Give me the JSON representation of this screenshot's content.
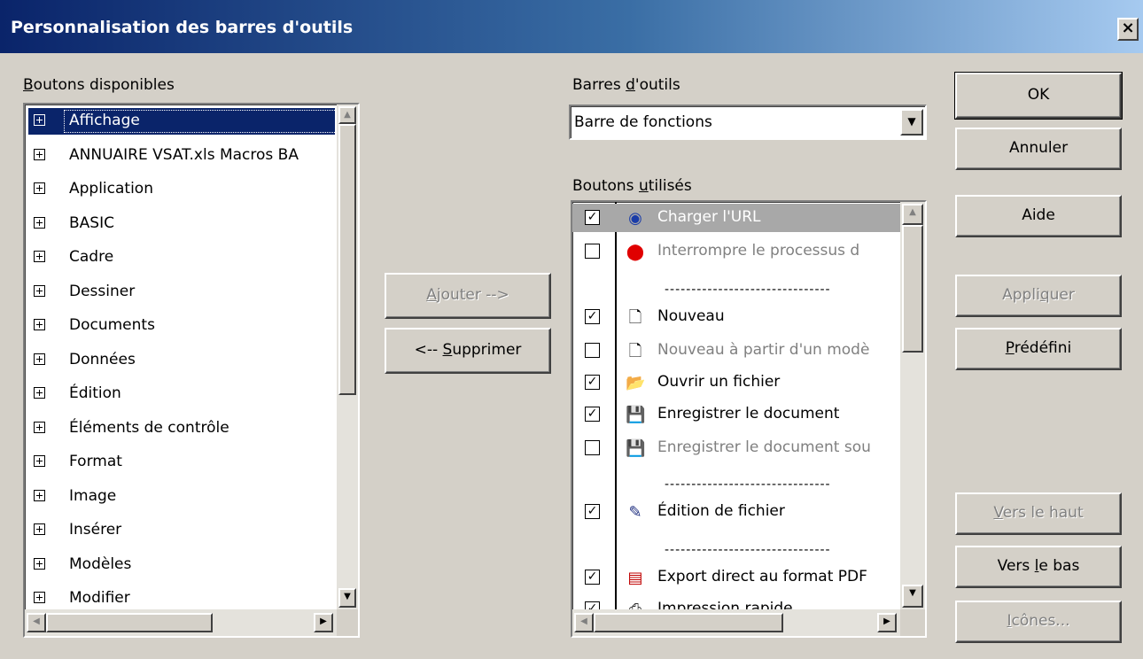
{
  "window": {
    "title": "Personnalisation des barres d'outils",
    "close_glyph": "×"
  },
  "available": {
    "label_prefix": "",
    "label_access": "B",
    "label_rest": "outons disponibles",
    "items": [
      "Affichage",
      "ANNUAIRE VSAT.xls Macros BA",
      "Application",
      "BASIC",
      "Cadre",
      "Dessiner",
      "Documents",
      "Données",
      "Édition",
      "Éléments de contrôle",
      "Format",
      "Image",
      "Insérer",
      "Modèles",
      "Modifier"
    ]
  },
  "middle": {
    "add": {
      "access": "A",
      "rest": "jouter -->"
    },
    "remove": {
      "prefix": "<-- ",
      "access": "S",
      "rest": "upprimer"
    }
  },
  "toolbars": {
    "label_prefix": "Barres ",
    "label_access": "d",
    "label_rest": "'outils",
    "selected": "Barre de fonctions"
  },
  "used": {
    "label_prefix": "Boutons ",
    "label_access": "u",
    "label_rest": "tilisés",
    "items": [
      {
        "checked": true,
        "icon": "url-load-icon",
        "label": "Charger l'URL",
        "dim": false
      },
      {
        "checked": false,
        "icon": "stop-icon",
        "label": "Interrompre le processus d",
        "dim": true
      },
      {
        "separator": true,
        "label": "-------------------------------"
      },
      {
        "checked": true,
        "icon": "new-document-icon",
        "label": "Nouveau",
        "dim": false
      },
      {
        "checked": false,
        "icon": "new-from-template-icon",
        "label": "Nouveau à partir d'un modè",
        "dim": true
      },
      {
        "checked": true,
        "icon": "open-folder-icon",
        "label": "Ouvrir un fichier",
        "dim": false
      },
      {
        "checked": true,
        "icon": "save-icon",
        "label": "Enregistrer le document",
        "dim": false
      },
      {
        "checked": false,
        "icon": "save-as-icon",
        "label": "Enregistrer le document sou",
        "dim": true
      },
      {
        "separator": true,
        "label": "-------------------------------"
      },
      {
        "checked": true,
        "icon": "edit-file-icon",
        "label": "Édition de fichier",
        "dim": false
      },
      {
        "separator": true,
        "label": "-------------------------------"
      },
      {
        "checked": true,
        "icon": "pdf-export-icon",
        "label": "Export direct au format PDF",
        "dim": false
      },
      {
        "checked": true,
        "icon": "print-icon",
        "label": "Impression rapide",
        "dim": false
      }
    ]
  },
  "buttons": {
    "ok": "OK",
    "cancel": "Annuler",
    "help": "Aide",
    "apply": {
      "prefix": "Appli",
      "access": "q",
      "rest": "uer"
    },
    "predefined": {
      "access": "P",
      "rest": "rédéfini"
    },
    "move_up": {
      "access": "V",
      "rest": "ers le haut"
    },
    "move_down": {
      "prefix": "Vers ",
      "access": "l",
      "rest": "e bas"
    },
    "icons": {
      "access": "I",
      "rest": "cônes..."
    }
  }
}
